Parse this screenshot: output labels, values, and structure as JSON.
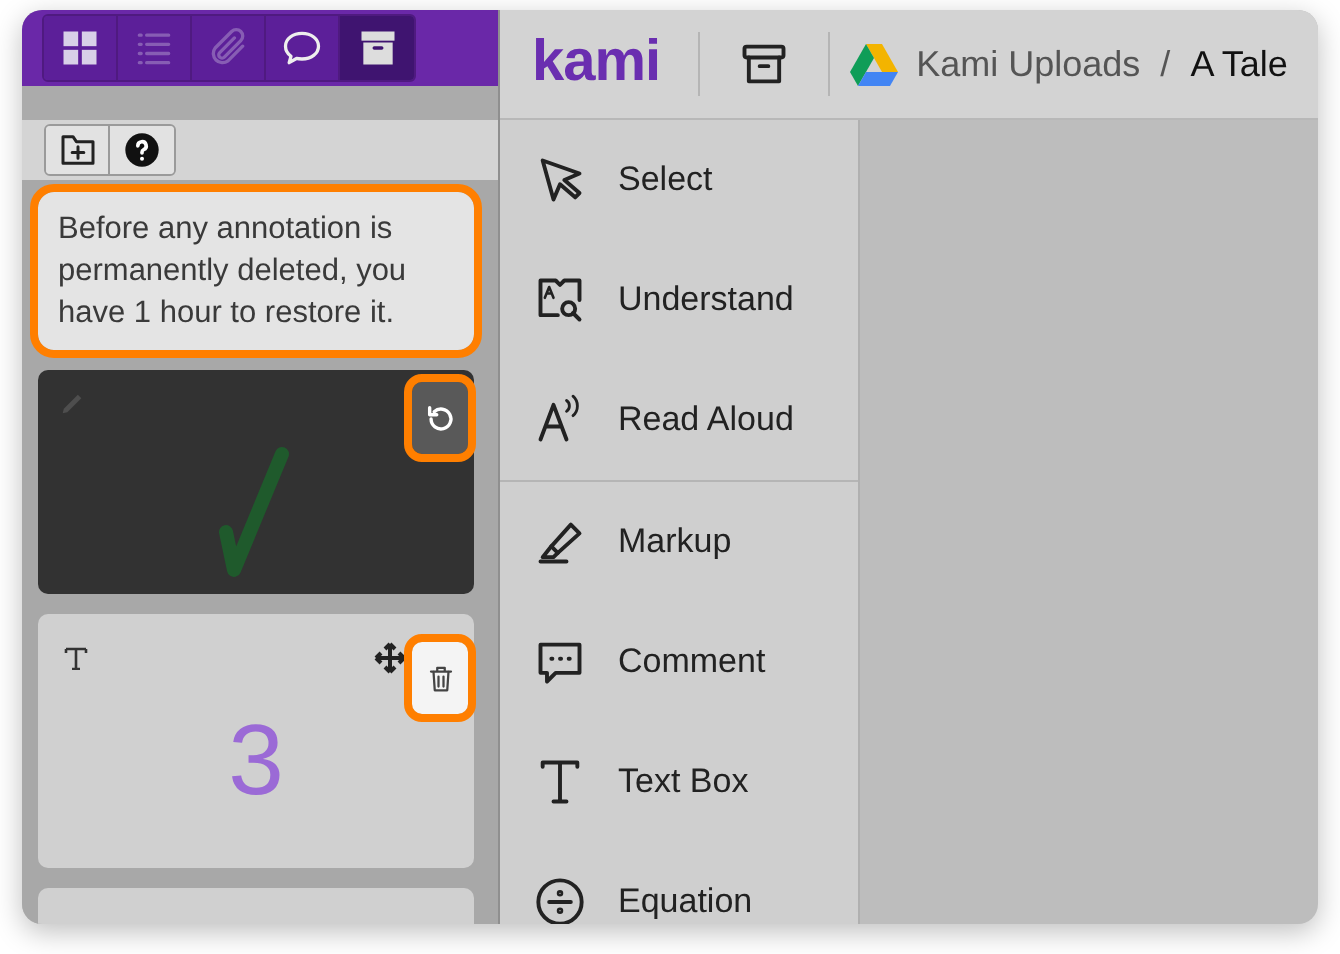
{
  "sidebar_tabs": [
    {
      "kind": "grid",
      "selected": false,
      "disabled": false
    },
    {
      "kind": "list",
      "selected": false,
      "disabled": true
    },
    {
      "kind": "attachment",
      "selected": false,
      "disabled": true
    },
    {
      "kind": "comment",
      "selected": false,
      "disabled": false
    },
    {
      "kind": "archive",
      "selected": true,
      "disabled": false
    }
  ],
  "header": {
    "logo": "kami",
    "breadcrumb": [
      {
        "label": "Kami Uploads",
        "current": false
      },
      {
        "label": "A Tale",
        "current": true
      }
    ],
    "separator": "/"
  },
  "panel_toolbar": [
    {
      "kind": "new-folder"
    },
    {
      "kind": "help"
    }
  ],
  "info_box": {
    "text": "Before any annotation is permanently deleted, you have 1 hour to restore it.",
    "highlighted": true
  },
  "annotations": [
    {
      "kind": "drawing",
      "action": {
        "kind": "restore",
        "highlighted": true
      }
    },
    {
      "kind": "text",
      "content": "3",
      "action": {
        "kind": "delete",
        "highlighted": true
      }
    },
    {
      "kind": "blank"
    }
  ],
  "tools": [
    {
      "kind": "select",
      "label": "Select"
    },
    {
      "kind": "understand",
      "label": "Understand"
    },
    {
      "kind": "read-aloud",
      "label": "Read Aloud"
    },
    {
      "kind": "divider"
    },
    {
      "kind": "markup",
      "label": "Markup"
    },
    {
      "kind": "comment",
      "label": "Comment"
    },
    {
      "kind": "text-box",
      "label": "Text Box"
    },
    {
      "kind": "equation",
      "label": "Equation"
    }
  ]
}
